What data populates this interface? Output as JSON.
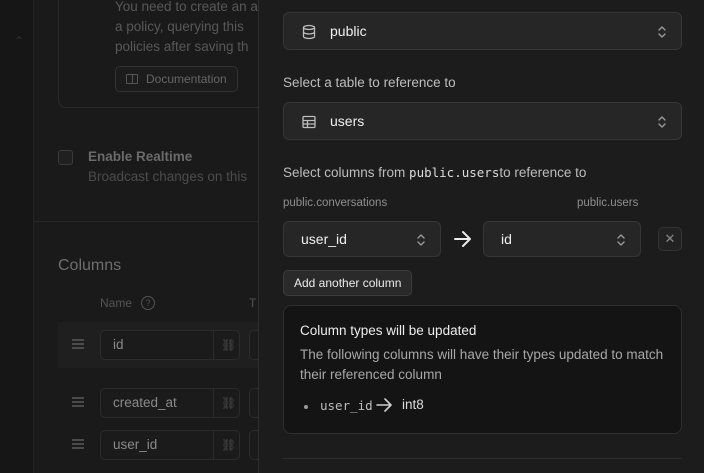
{
  "background": {
    "policy_text": [
      "You need to create an a",
      "a policy, querying this",
      "policies after saving th"
    ],
    "documentation_label": "Documentation",
    "realtime_title": "Enable Realtime",
    "realtime_subtitle": "Broadcast changes on this",
    "columns_heading": "Columns",
    "name_header": "Name",
    "type_header_partial": "T",
    "rows": [
      "id",
      "created_at",
      "user_id"
    ]
  },
  "panel": {
    "schema_select": {
      "value": "public",
      "icon": "database-icon"
    },
    "table_label": "Select a table to reference to",
    "table_select": {
      "value": "users",
      "icon": "table-icon"
    },
    "columns_label_prefix": "Select columns from ",
    "columns_label_table": "public.users",
    "columns_label_suffix": "to reference to",
    "source_table": "public.conversations",
    "target_table": "public.users",
    "source_column": "user_id",
    "target_column": "id",
    "add_column_label": "Add another column",
    "notice": {
      "title": "Column types will be updated",
      "body": "The following columns will have their types updated to match their referenced column",
      "items": [
        {
          "column": "user_id",
          "new_type": "int8"
        }
      ]
    }
  }
}
